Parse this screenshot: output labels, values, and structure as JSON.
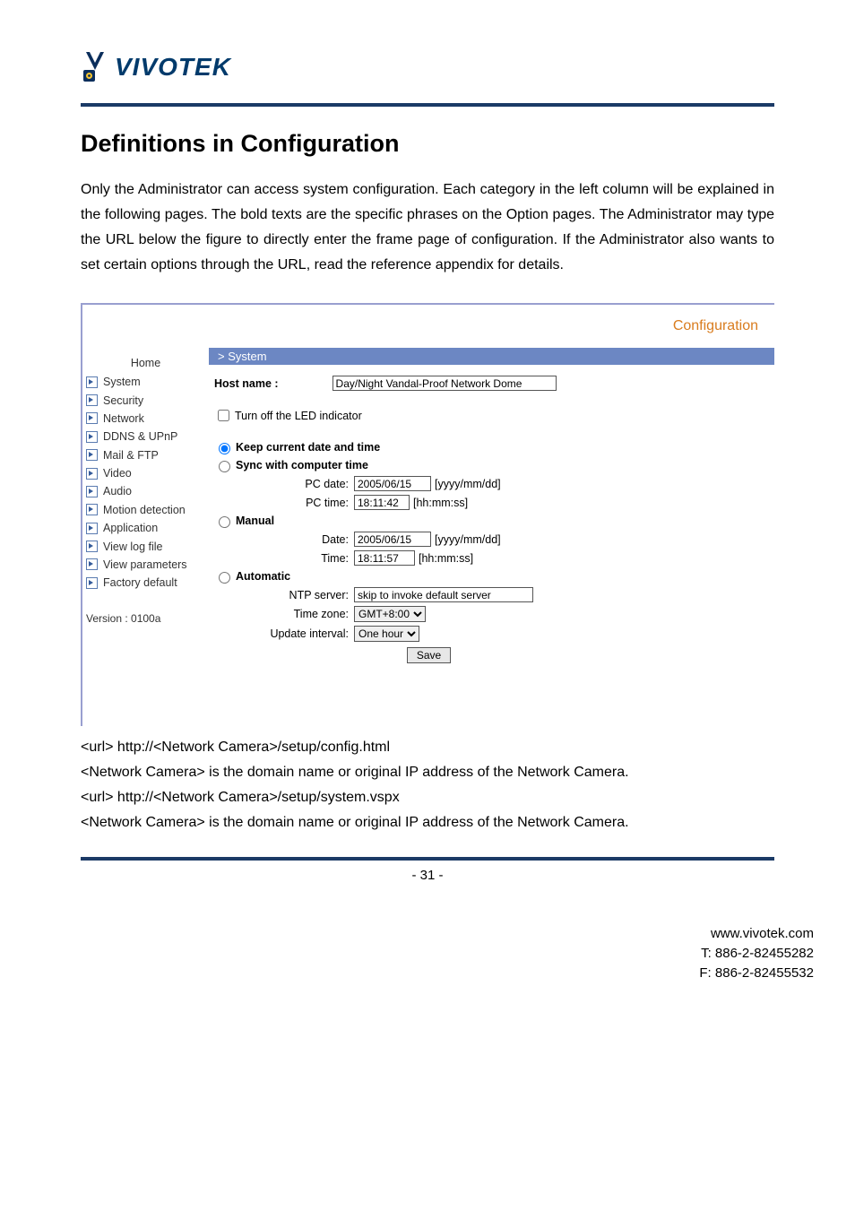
{
  "logo": {
    "text": "VIVOTEK"
  },
  "heading": "Definitions in Configuration",
  "intro": "Only the Administrator can access system configuration. Each category in the left column will be explained in the following pages. The bold texts are the specific phrases on the Option pages. The Administrator may type the URL below the figure to directly enter the frame page of configuration. If the Administrator also wants to set certain options through the URL, read the reference appendix for details.",
  "screenshot": {
    "header_link": "Configuration",
    "sidebar": {
      "home": "Home",
      "items": [
        "System",
        "Security",
        "Network",
        "DDNS & UPnP",
        "Mail & FTP",
        "Video",
        "Audio",
        "Motion detection",
        "Application",
        "View log file",
        "View parameters",
        "Factory default"
      ],
      "version": "Version : 0100a"
    },
    "crumb": "> System",
    "form": {
      "hostname_label": "Host name :",
      "hostname_value": "Day/Night Vandal-Proof Network Dome",
      "led_label": "Turn off the LED indicator",
      "opt_keep": "Keep current date and time",
      "opt_sync": "Sync with computer time",
      "pc_date_label": "PC date:",
      "pc_date_value": "2005/06/15",
      "date_fmt": "[yyyy/mm/dd]",
      "pc_time_label": "PC time:",
      "pc_time_value": "18:11:42",
      "time_fmt": "[hh:mm:ss]",
      "opt_manual": "Manual",
      "man_date_label": "Date:",
      "man_date_value": "2005/06/15",
      "man_time_label": "Time:",
      "man_time_value": "18:11:57",
      "opt_auto": "Automatic",
      "ntp_label": "NTP server:",
      "ntp_value": "skip to invoke default server",
      "tz_label": "Time zone:",
      "tz_value": "GMT+8:00",
      "upd_label": "Update interval:",
      "upd_value": "One hour",
      "save": "Save"
    }
  },
  "post": {
    "l1": "<url> http://<Network Camera>/setup/config.html",
    "l2": "<Network Camera> is the domain name or original IP address of the Network Camera.",
    "l3": "<url> http://<Network Camera>/setup/system.vspx",
    "l4": "<Network Camera> is the domain name or original IP address of the Network Camera."
  },
  "page_num": "- 31 -",
  "footer": {
    "site": "www.vivotek.com",
    "tel": "T: 886-2-82455282",
    "fax": "F: 886-2-82455532"
  }
}
